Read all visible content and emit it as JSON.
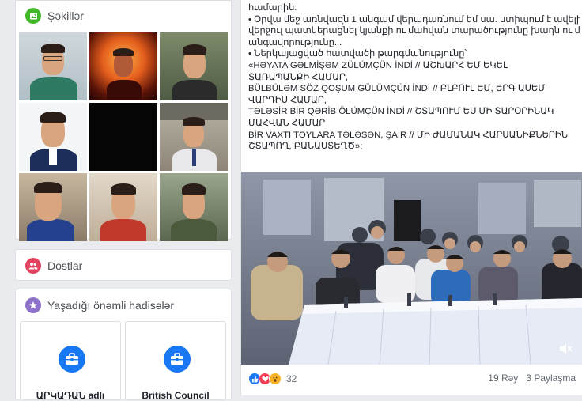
{
  "photos_card": {
    "title": "Şəkillər"
  },
  "friends_card": {
    "title": "Dostlar"
  },
  "events_card": {
    "title": "Yaşadığı önəmli hadisələr",
    "items": [
      {
        "label": "ԱՐԿԱԴԱՆ adlı"
      },
      {
        "label": "British Council"
      }
    ]
  },
  "post": {
    "lines": [
      "համարին:",
      "• Օրվա մեջ առնվազն 1 անգամ վերադառնում եմ սա. ստիպում է ավելի",
      "վերջուլ պատկերացնել կյանքի ու մահվան տարածությունը խաղն ու մարդուս",
      "անգավորությունը...",
      "• Ներկայացված հատվածի թարգմանությունը՝",
      "«HƏYATA GƏLMİŞƏM ZÜLÜMÇÜN İNDİ // ԱՇԽԱՐՀ ԵՄ ԵԿԵԼ",
      "ՏԱՌԱՊԱՆՔԻ ՀԱՄԱՐ,",
      "BÜLBÜLƏM SÖZ QOŞUM GÜLÜMÇÜN İNDİ // ԲԼԲՈՒԼ ԵՄ, ԵՐԳ ԱՍԵՄ",
      "ՎԱՐԴԻՍ ՀԱՄԱՐ,",
      "TƏLƏSİR BİR QƏRİB ÖLÜMÇÜN İNDİ // ՇՏԱՊՈՒՄ ԵՍ ՄԻ ՏԱՐՕՐԻՆԱԿ",
      "ՄԱՀՎԱՆ ՀԱՄԱՐ",
      "BİR VAXTI TOYLARA TƏLƏSƏN, ŞAİR // ՄԻ ԺԱՄԱՆԱԿ ՀԱՐՍԱՆԻՔՆԵՐԻՆ",
      "ՇՏԱՊՈՂ, ԲԱՆԱՍՏԵՂԾ»:"
    ],
    "reaction_count": "32",
    "stats": "19 Rəy   3 Paylaşma"
  },
  "colors": {
    "accent": "#1877f2",
    "photos_icon": "#42b72a",
    "friends_icon": "#e4405f",
    "events_icon": "#8c72cb"
  },
  "icons": {
    "photos": "photo-icon",
    "friends": "friends-icon",
    "events": "star-icon",
    "briefcase": "briefcase-icon",
    "volume": "volume-icon"
  }
}
